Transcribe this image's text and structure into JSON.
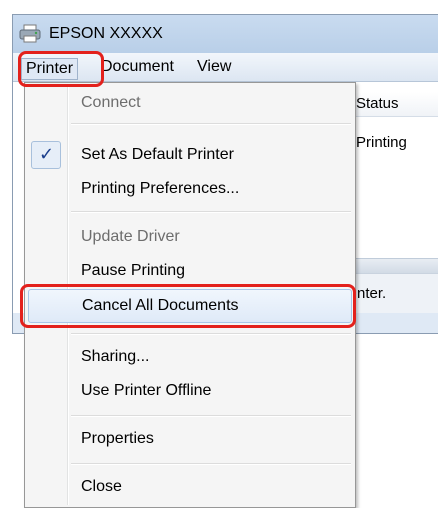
{
  "window": {
    "title": "EPSON XXXXX"
  },
  "menubar": {
    "printer": "Printer",
    "document": "Document",
    "view": "View"
  },
  "list": {
    "column_status": "Status",
    "status_value": "Printing",
    "statusbar_text": "nter."
  },
  "dropdown": {
    "connect": "Connect",
    "check_mark": "✓",
    "set_default": "Set As Default Printer",
    "printing_preferences": "Printing Preferences...",
    "update_driver": "Update Driver",
    "pause_printing": "Pause Printing",
    "cancel_all": "Cancel All Documents",
    "sharing": "Sharing...",
    "use_offline": "Use Printer Offline",
    "properties": "Properties",
    "close": "Close"
  },
  "colors": {
    "annotation": "#e3211c",
    "menu_bg": "#f5f5f5"
  }
}
